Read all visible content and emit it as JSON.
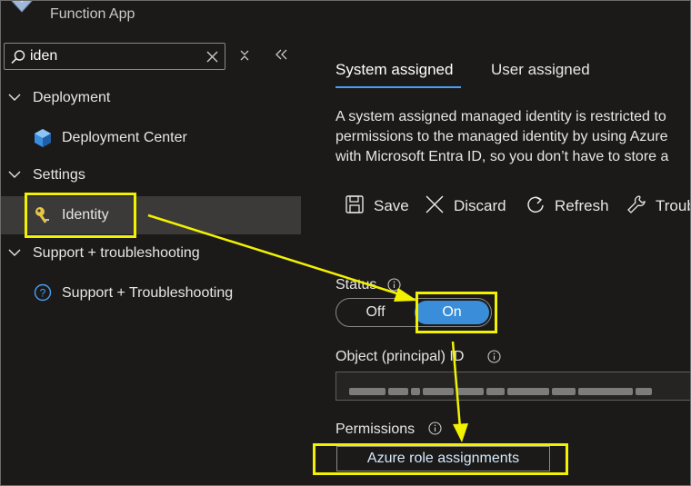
{
  "header": {
    "app_type": "Function App"
  },
  "search": {
    "value": "iden",
    "placeholder": ""
  },
  "sidebar": {
    "groups": [
      {
        "label": "Deployment",
        "items": [
          {
            "label": "Deployment Center"
          }
        ]
      },
      {
        "label": "Settings",
        "items": [
          {
            "label": "Identity"
          }
        ]
      },
      {
        "label": "Support + troubleshooting",
        "items": [
          {
            "label": "Support + Troubleshooting"
          }
        ]
      }
    ]
  },
  "tabs": [
    {
      "label": "System assigned",
      "active": true
    },
    {
      "label": "User assigned",
      "active": false
    }
  ],
  "description": {
    "lines": [
      "A system assigned managed identity is restricted to",
      "permissions to the managed identity by using Azure",
      "with Microsoft Entra ID, so you don’t have to store a"
    ]
  },
  "toolbar": {
    "save": "Save",
    "discard": "Discard",
    "refresh": "Refresh",
    "troubleshoot": "Troubl"
  },
  "status": {
    "label": "Status",
    "off": "Off",
    "on": "On",
    "value": "On"
  },
  "object_id": {
    "label": "Object (principal) ID",
    "value": ""
  },
  "permissions": {
    "label": "Permissions",
    "button": "Azure role assignments"
  },
  "colors": {
    "accent": "#479ef5",
    "toggle_on": "#3a8dd8",
    "annotation": "#f2f200",
    "background": "#1b1a19",
    "selected_row": "#3b3a39"
  }
}
